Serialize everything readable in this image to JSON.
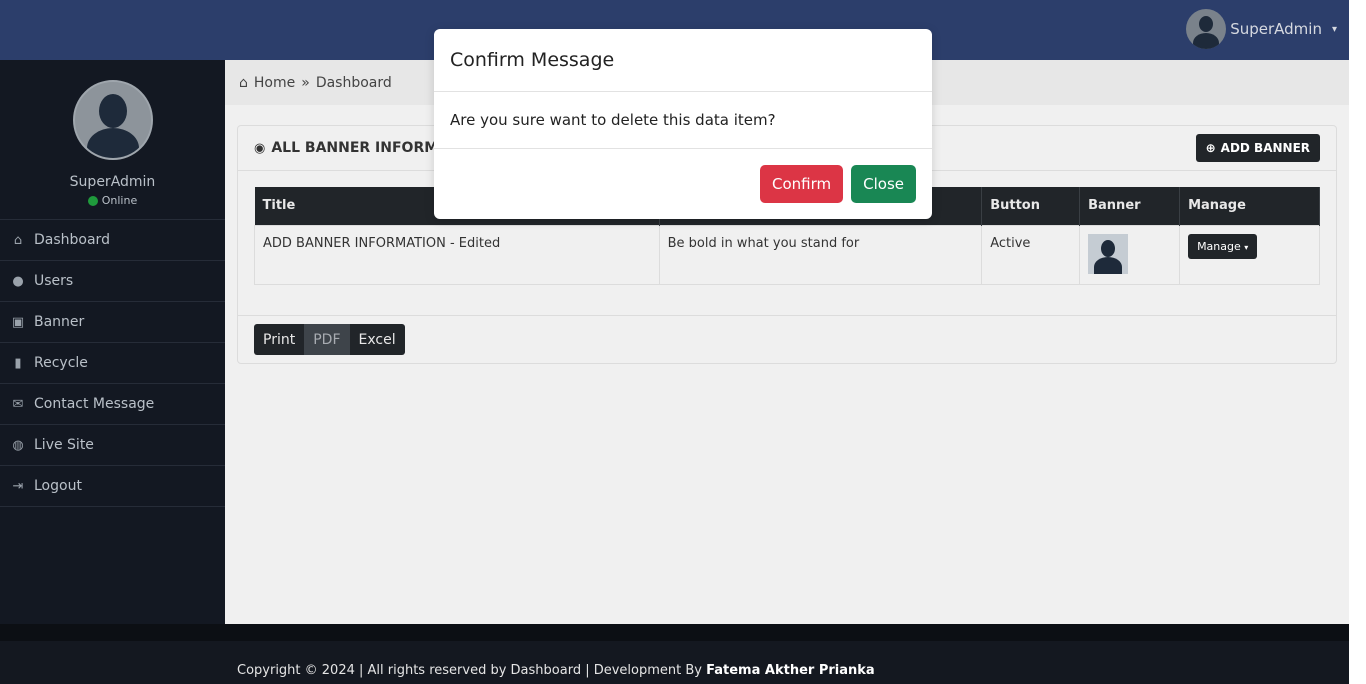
{
  "header": {
    "user_name": "SuperAdmin",
    "caret": "▾"
  },
  "sidebar": {
    "profile_name": "SuperAdmin",
    "status": "Online",
    "status_color": "#1f9a3c",
    "items": [
      {
        "label": "Dashboard",
        "icon": "home-icon",
        "glyph": "⌂"
      },
      {
        "label": "Users",
        "icon": "user-circle-icon",
        "glyph": "●"
      },
      {
        "label": "Banner",
        "icon": "images-icon",
        "glyph": "▣"
      },
      {
        "label": "Recycle",
        "icon": "trash-icon",
        "glyph": "▮"
      },
      {
        "label": "Contact Message",
        "icon": "comments-icon",
        "glyph": "✉"
      },
      {
        "label": "Live Site",
        "icon": "globe-icon",
        "glyph": "◍"
      },
      {
        "label": "Logout",
        "icon": "sign-out-icon",
        "glyph": "⇥"
      }
    ]
  },
  "breadcrumb": {
    "home": "Home",
    "separator": "»",
    "current": "Dashboard"
  },
  "card": {
    "title": "ALL BANNER INFORMATION",
    "add_button": "ADD BANNER",
    "columns": [
      "Title",
      "",
      "Button",
      "Banner",
      "Manage"
    ],
    "rows": [
      {
        "title": "ADD BANNER INFORMATION - Edited",
        "subtitle": "Be bold in what you stand for",
        "button": "Active",
        "manage": "Manage"
      }
    ],
    "exports": [
      "Print",
      "PDF",
      "Excel"
    ]
  },
  "footer": {
    "text": "Copyright © 2024 | All rights reserved by Dashboard | Development By",
    "author": "Fatema Akther Prianka"
  },
  "modal": {
    "title": "Confirm Message",
    "body": "Are you sure want to delete this data item?",
    "confirm": "Confirm",
    "close": "Close"
  },
  "colors": {
    "navbar": "#2c3e6b",
    "sidebar": "#131822",
    "danger": "#dc3545",
    "success": "#198754",
    "dark_button": "#212529"
  }
}
